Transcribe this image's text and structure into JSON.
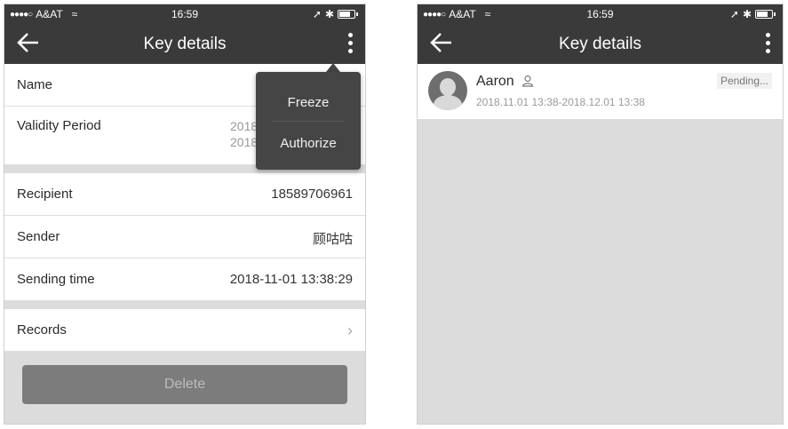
{
  "left_screen": {
    "status_bar": {
      "carrier": "A&AT",
      "time": "16:59"
    },
    "nav": {
      "title": "Key details"
    },
    "rows": {
      "name_label": "Name",
      "validity_label": "Validity Period",
      "validity_value_line1": "2018",
      "validity_value_line2": "2018",
      "recipient_label": "Recipient",
      "recipient_value": "18589706961",
      "sender_label": "Sender",
      "sender_value": "顾咕咕",
      "sending_time_label": "Sending time",
      "sending_time_value": "2018-11-01 13:38:29",
      "records_label": "Records"
    },
    "popup_menu": {
      "items": [
        "Freeze",
        "Authorize"
      ]
    },
    "delete_label": "Delete"
  },
  "right_screen": {
    "status_bar": {
      "carrier": "A&AT",
      "time": "16:59"
    },
    "nav": {
      "title": "Key details"
    },
    "list": [
      {
        "name": "Aaron",
        "period": "2018.11.01 13:38-2018.12.01 13:38",
        "status": "Pending..."
      }
    ]
  },
  "colors": {
    "nav_bg": "#3a3a3a",
    "page_bg": "#dcdcdc",
    "delete_bg": "#7c7c7c",
    "popup_bg": "#454545"
  }
}
